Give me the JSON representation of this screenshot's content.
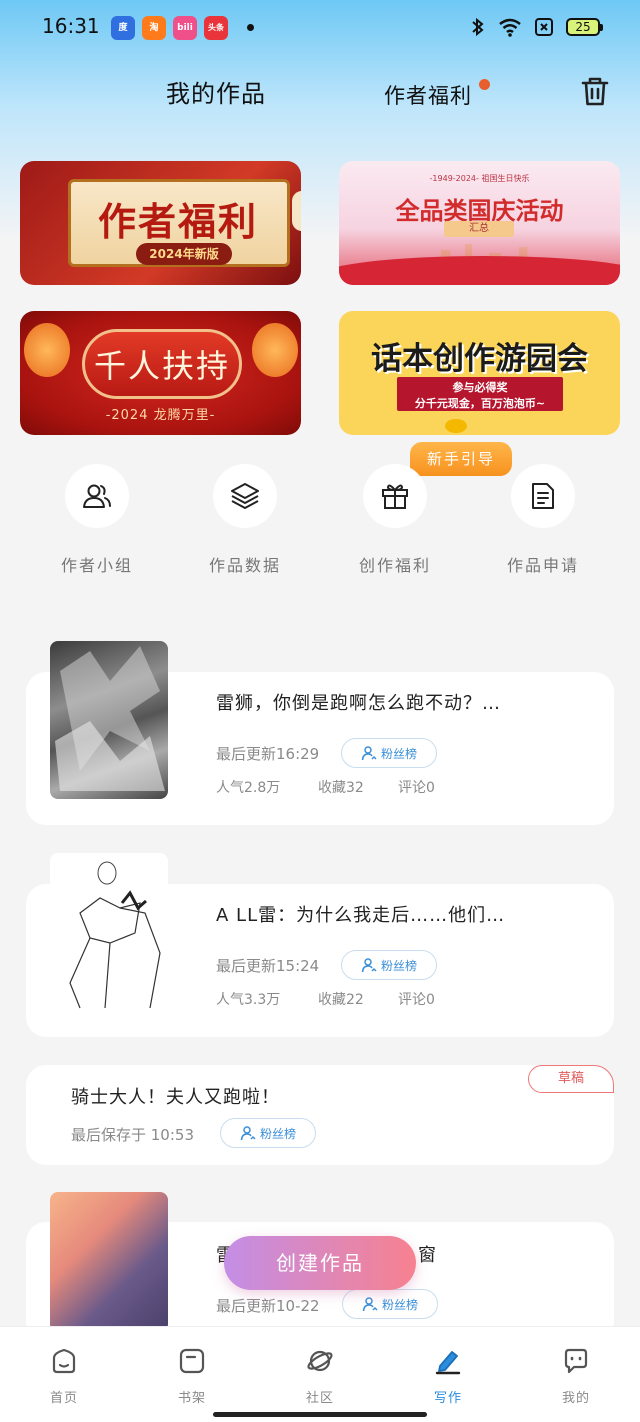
{
  "status_bar": {
    "time": "16:31",
    "apps": [
      "度",
      "淘",
      "bili",
      "头条"
    ],
    "battery": "25"
  },
  "header": {
    "tab_works": "我的作品",
    "tab_benefits": "作者福利",
    "trash_icon": "trash-icon"
  },
  "banners": {
    "b1_title": "作者福利",
    "b1_sub": "2024年新版",
    "b2_tiny": "-1949-2024- 祖国生日快乐",
    "b2_title": "全品类国庆活动",
    "b2_sub": "汇总",
    "b3_title": "千人扶持",
    "b3_sub": "-2024 龙腾万里-",
    "b4_title": "话本创作游园会",
    "b4_line1": "参与必得奖",
    "b4_line2": "分千元现金，百万泡泡币~"
  },
  "guide_badge": "新手引导",
  "shortcuts": [
    {
      "label": "作者小组",
      "icon": "users-icon"
    },
    {
      "label": "作品数据",
      "icon": "layers-icon"
    },
    {
      "label": "创作福利",
      "icon": "gift-icon"
    },
    {
      "label": "作品申请",
      "icon": "document-icon"
    }
  ],
  "works": [
    {
      "title": "雷狮，你倒是跑啊怎么跑不动？…",
      "updated": "最后更新16:29",
      "fan_btn": "粉丝榜",
      "popularity": "人气2.8万",
      "favorites": "收藏32",
      "comments": "评论0"
    },
    {
      "title": "A LL雷：为什么我走后……他们…",
      "updated": "最后更新15:24",
      "fan_btn": "粉丝榜",
      "popularity": "人气3.3万",
      "favorites": "收藏22",
      "comments": "评论0"
    },
    {
      "title": "骑士大人！夫人又跑啦！",
      "saved": "最后保存于 10:53",
      "fan_btn": "粉丝榜",
      "draft_tag": "草稿"
    },
    {
      "title_start": "雷",
      "title_end": "窗",
      "updated": "最后更新10-22",
      "fan_btn": "粉丝榜"
    }
  ],
  "create_button": "创建作品",
  "bottom_nav": [
    {
      "label": "首页",
      "icon": "home-icon"
    },
    {
      "label": "书架",
      "icon": "bookshelf-icon"
    },
    {
      "label": "社区",
      "icon": "planet-icon"
    },
    {
      "label": "写作",
      "icon": "pen-icon"
    },
    {
      "label": "我的",
      "icon": "chat-icon"
    }
  ],
  "colors": {
    "accent_blue": "#2a8de0",
    "guide_orange": "#f7921f",
    "draft_red": "#e15a5a"
  }
}
